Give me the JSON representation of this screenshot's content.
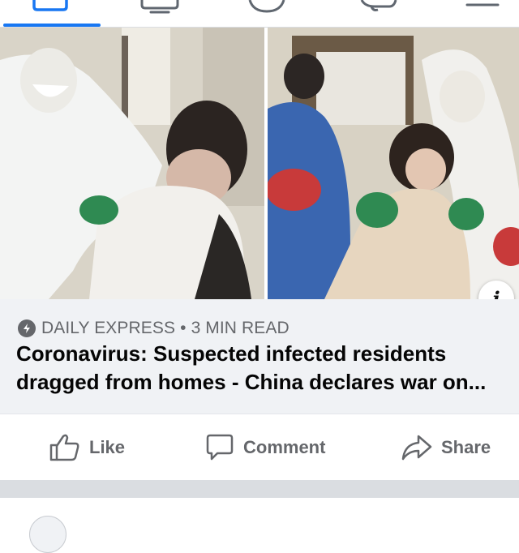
{
  "nav": {
    "tabs": [
      {
        "icon": "home-icon",
        "active": true
      },
      {
        "icon": "watch-icon",
        "active": false
      },
      {
        "icon": "groups-icon",
        "active": false
      },
      {
        "icon": "notifications-icon",
        "active": false
      },
      {
        "icon": "menu-icon",
        "active": false
      }
    ],
    "accent": "#1877f2"
  },
  "preview": {
    "info_icon": "i",
    "source": "DAILY EXPRESS",
    "separator": "•",
    "read_time": "3 MIN READ",
    "headline_line1": "Coronavirus: Suspected infected residents",
    "headline_line2": "dragged from homes - China declares war on..."
  },
  "actions": {
    "like": "Like",
    "comment": "Comment",
    "share": "Share"
  },
  "colors": {
    "caption_bg": "#f0f2f5",
    "secondary_text": "#65676b",
    "primary_text": "#050505"
  }
}
